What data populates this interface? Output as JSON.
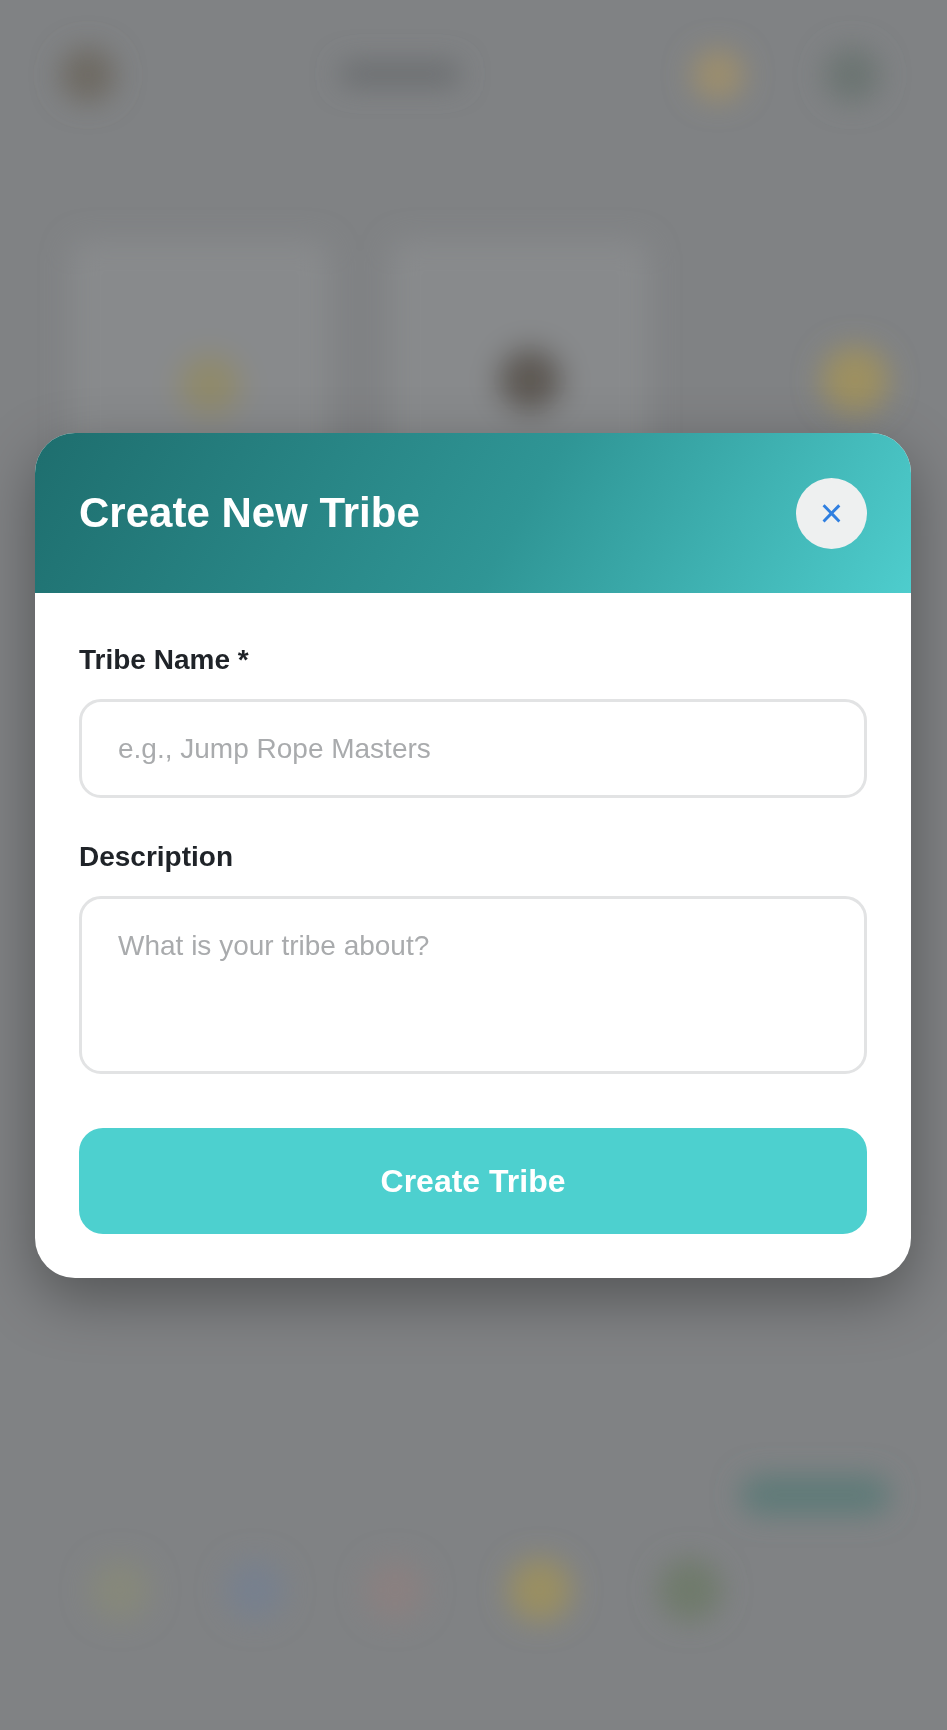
{
  "modal": {
    "title": "Create New Tribe",
    "close_label": "×",
    "fields": [
      {
        "kind": "input",
        "label": "Tribe Name *",
        "placeholder": "e.g., Jump Rope Masters"
      },
      {
        "kind": "textarea",
        "label": "Description",
        "placeholder": "What is your tribe about?"
      }
    ],
    "submit": "Create Tribe"
  }
}
